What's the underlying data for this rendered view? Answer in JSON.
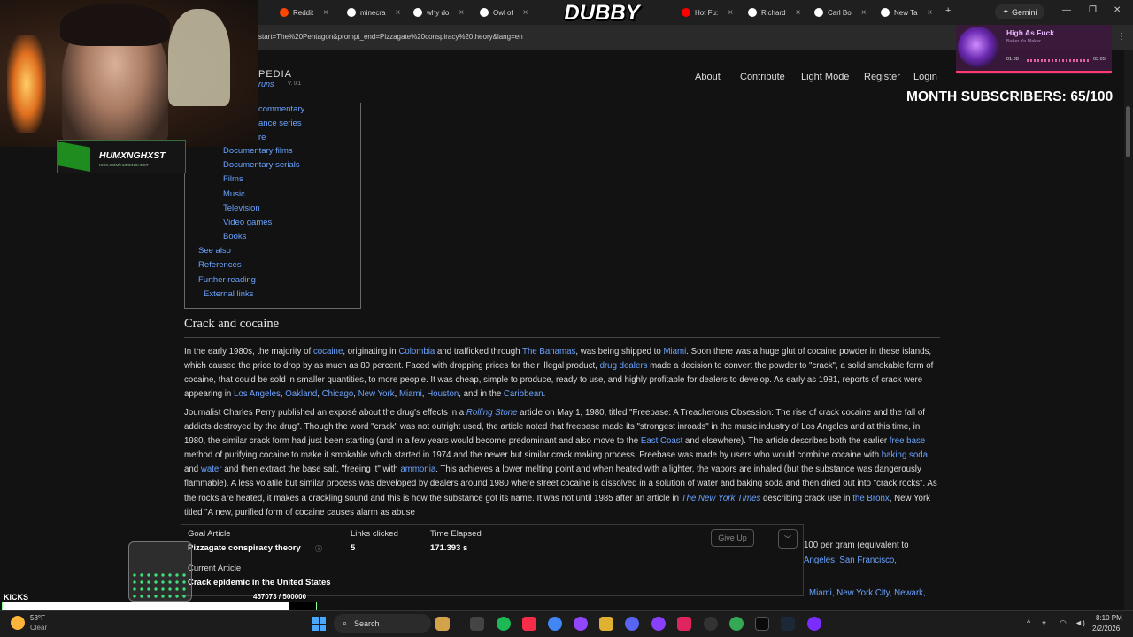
{
  "browser": {
    "tabs": [
      {
        "label": "Reddit",
        "color": "#ff4500"
      },
      {
        "label": "minecra",
        "color": "#ffffff"
      },
      {
        "label": "why do",
        "color": "#ffffff"
      },
      {
        "label": "Owl of",
        "color": "#ffffff"
      },
      {
        "label": "Hot Fu:",
        "color": "#ff0000"
      },
      {
        "label": "Richard",
        "color": "#ffffff"
      },
      {
        "label": "Carl Bo",
        "color": "#ffffff"
      },
      {
        "label": "New Ta",
        "color": "#ffffff"
      }
    ],
    "new_tab": "+",
    "gemini_label": "Gemini",
    "url": "start=The%20Pentagon&prompt_end=Pizzagate%20conspiracy%20theory&lang=en"
  },
  "site": {
    "logo_top": "PEDIA",
    "logo_bottom": "runs",
    "version": "V. 0.1",
    "nav": [
      "About",
      "Contribute",
      "Light Mode",
      "Register",
      "Login"
    ]
  },
  "toc": [
    {
      "label": "commentary",
      "level": 2
    },
    {
      "label": "ance series",
      "level": 2
    },
    {
      "label": "re",
      "level": 2
    },
    {
      "label": "Documentary films",
      "level": 3
    },
    {
      "label": "Documentary serials",
      "level": 3
    },
    {
      "label": "Films",
      "level": 3
    },
    {
      "label": "Music",
      "level": 3
    },
    {
      "label": "Television",
      "level": 3
    },
    {
      "label": "Video games",
      "level": 3
    },
    {
      "label": "Books",
      "level": 3
    },
    {
      "label": "See also",
      "level": 1
    },
    {
      "label": "References",
      "level": 1
    },
    {
      "label": "Further reading",
      "level": 1
    },
    {
      "label": "External links",
      "level": 1
    }
  ],
  "article": {
    "section_heading": "Crack and cocaine",
    "para1": "In the early 1980s, the majority of <a>cocaine</a>, originating in <a>Colombia</a> and trafficked through <a>The Bahamas</a>, was being shipped to <a>Miami</a>. Soon there was a huge glut of cocaine powder in these islands, which caused the price to drop by as much as 80 percent. Faced with dropping prices for their illegal product, <a>drug dealers</a> made a decision to convert the powder to \"crack\", a solid smokable form of cocaine, that could be sold in smaller quantities, to more people. It was cheap, simple to produce, ready to use, and highly profitable for dealers to develop. As early as 1981, reports of crack were appearing in <a>Los Angeles</a>, <a>Oakland</a>, <a>Chicago</a>, <a>New York</a>, <a>Miami</a>, <a>Houston</a>, and in the <a>Caribbean</a>.",
    "para2": "Journalist Charles Perry published an exposé about the drug's effects in a <a><i>Rolling Stone</i></a> article on May 1, 1980, titled \"Freebase: A Treacherous Obsession: The rise of crack cocaine and the fall of addicts destroyed by the drug\". Though the word \"crack\" was not outright used, the article noted that freebase made its \"strongest inroads\" in the music industry of Los Angeles and at this time, in 1980, the similar crack form had just been starting (and in a few years would become predominant and also move to the <a>East Coast</a> and elsewhere). The article describes both the earlier <a>free base</a> method of purifying cocaine to make it smokable which started in 1974 and the newer but similar crack making process. Freebase was made by users who would combine cocaine with <a>baking soda</a> and <a>water</a> and then extract the base salt, \"freeing it\" with <a>ammonia</a>. This achieves a lower melting point and when heated with a lighter, the vapors are inhaled (but the substance was dangerously flammable). A less volatile but similar process was developed by dealers around 1980 where street cocaine is dissolved in a solution of water and baking soda and then dried out into \"crack rocks\". As the rocks are heated, it makes a crackling sound and this is how the substance got its name. It was not until 1985 after an article in <a><i>The New York Times</i></a> describing crack use in <a>the Bronx</a>, New York titled \"A new, purified form of cocaine causes alarm as abuse",
    "right_fragment_1": "100 per gram (equivalent to",
    "right_fragment_2": "Angeles, San Francisco,",
    "bottom_fragment": "Miami, New York City, Newark,"
  },
  "game": {
    "goal_label": "Goal Article",
    "goal_value": "Pizzagate conspiracy theory",
    "links_label": "Links clicked",
    "links_value": "5",
    "time_label": "Time Elapsed",
    "time_value": "171.393 s",
    "current_label": "Current Article",
    "current_value": "Crack epidemic in the United States",
    "give_up": "Give Up"
  },
  "stream": {
    "subscribers": "MONTH SUBSCRIBERS: 65/100",
    "dubby": "DUBBY",
    "channel_name": "HUMXNGHXST",
    "channel_sub": "KICK.COM/HUMXNGHXST",
    "music_title": "High As Fuck",
    "music_artist": "Baker Ya Maker",
    "music_elapsed": "01:38",
    "music_total": "03:05",
    "music_progress": 0.53,
    "kicks_label": "KICKS",
    "kicks_count": "457073 / 500000",
    "kicks_progress": 0.914
  },
  "taskbar": {
    "temperature": "58°F",
    "condition": "Clear",
    "search_label": "Search",
    "time": "8:10 PM",
    "date": "2/2/2026"
  }
}
